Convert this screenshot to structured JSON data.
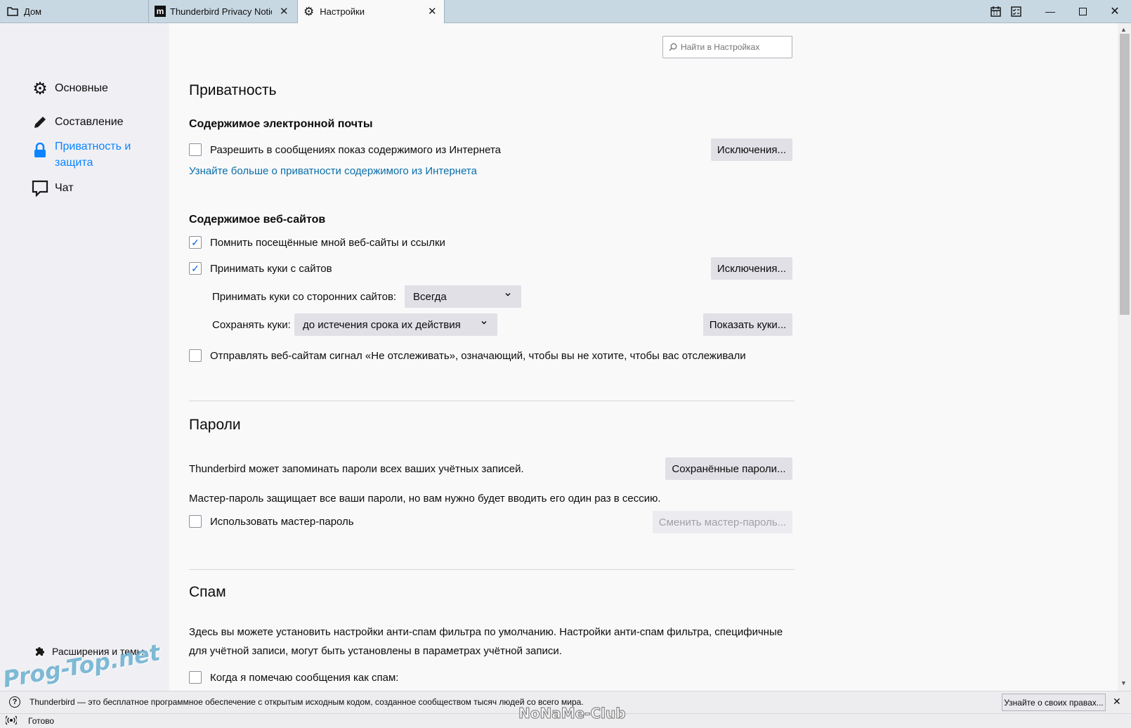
{
  "tabs": [
    {
      "label": "Дом",
      "icon": "folder-icon"
    },
    {
      "label": "Thunderbird Privacy Notice",
      "icon": "mozilla-m-icon"
    },
    {
      "label": "Настройки",
      "icon": "gear-icon"
    }
  ],
  "search": {
    "placeholder": "Найти в Настройках"
  },
  "sidebar": {
    "items": [
      {
        "label": "Основные",
        "icon": "gear-icon"
      },
      {
        "label": "Составление",
        "icon": "pencil-icon"
      },
      {
        "label": "Приватность и защита",
        "icon": "lock-icon"
      },
      {
        "label": "Чат",
        "icon": "chat-bubble-icon"
      }
    ],
    "extensions_label": "Расширения и темы"
  },
  "privacy": {
    "title": "Приватность",
    "email_heading": "Содержимое электронной почты",
    "allow_remote_label": "Разрешить в сообщениях показ содержимого из Интернета",
    "allow_remote_checked": false,
    "exceptions_label": "Исключения...",
    "learn_more": "Узнайте больше о приватности содержимого из Интернета",
    "web_heading": "Содержимое веб-сайтов",
    "remember_label": "Помнить посещённые мной веб-сайты и ссылки",
    "remember_checked": true,
    "accept_cookies_label": "Принимать куки с сайтов",
    "accept_cookies_checked": true,
    "exceptions2_label": "Исключения...",
    "third_party_label": "Принимать куки со сторонних сайтов:",
    "third_party_value": "Всегда",
    "keep_label": "Сохранять куки:",
    "keep_value": "до истечения срока их действия",
    "show_cookies_label": "Показать куки...",
    "dnt_label": "Отправлять веб-сайтам сигнал «Не отслеживать», означающий, чтобы вы не хотите, чтобы вас отслеживали",
    "dnt_checked": false
  },
  "passwords": {
    "title": "Пароли",
    "desc": "Thunderbird может запоминать пароли всех ваших учётных записей.",
    "saved_label": "Сохранённые пароли...",
    "master_desc": "Мастер-пароль защищает все ваши пароли, но вам нужно будет вводить его один раз в сессию.",
    "use_master_label": "Использовать мастер-пароль",
    "use_master_checked": false,
    "change_master_label": "Сменить мастер-пароль..."
  },
  "spam": {
    "title": "Спам",
    "desc_line1": "Здесь вы можете установить настройки анти-спам фильтра по умолчанию. Настройки анти-спам фильтра, специфичные",
    "desc_line2": "для учётной записи, могут быть установлены в параметрах учётной записи.",
    "mark_label": "Когда я помечаю сообщения как спам:"
  },
  "notification": {
    "text": "Thunderbird — это бесплатное программное обеспечение с открытым исходным кодом, созданное сообществом тысяч людей со всего мира.",
    "button": "Узнайте о своих правах..."
  },
  "status": {
    "text": "Готово"
  },
  "watermarks": {
    "left": "Prog-Top.net",
    "center": "NoNaMe-Club"
  },
  "colors": {
    "accent": "#0a84ff",
    "link": "#0a6ea8"
  }
}
